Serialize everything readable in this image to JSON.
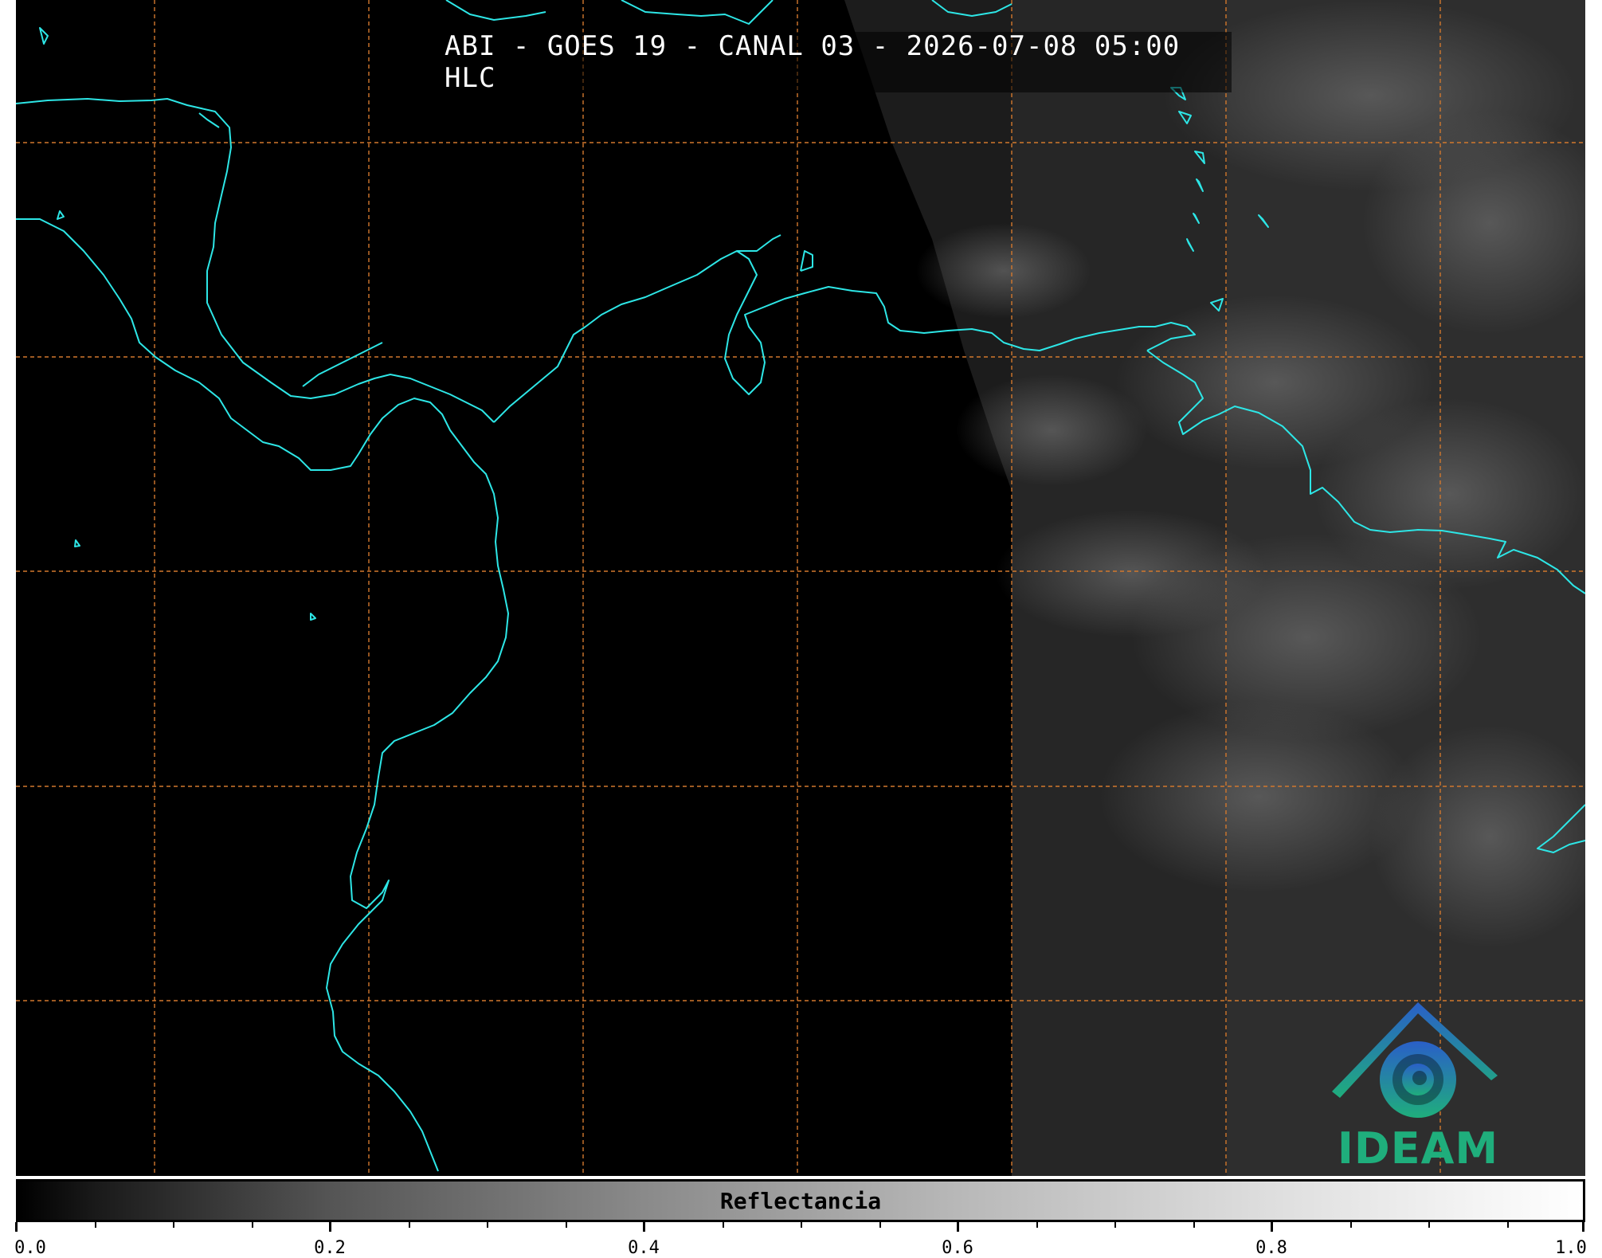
{
  "title": "ABI - GOES 19 - CANAL 03 - 2026-07-08 05:00 HLC",
  "colors": {
    "background": "#000000",
    "coastline": "#2de6e6",
    "gridlines": "#d2782d",
    "title_text": "#ffffff",
    "logo_blue": "#2a78c8",
    "logo_green": "#1fae7c"
  },
  "map": {
    "layers": [
      "visible-reflectance-imagery",
      "coastlines",
      "lat-lon-grid"
    ],
    "gridline_style": "dashed"
  },
  "logo": {
    "text": "IDEAM",
    "icon": "ideam-mountain-spiral-logo"
  },
  "colorbar": {
    "label": "Reflectancia",
    "colormap": "grayscale",
    "range": [
      0.0,
      1.0
    ],
    "tick_labels": [
      "0.0",
      "0.2",
      "0.4",
      "0.6",
      "0.8",
      "1.0"
    ],
    "minor_ticks_per_interval": 4
  }
}
